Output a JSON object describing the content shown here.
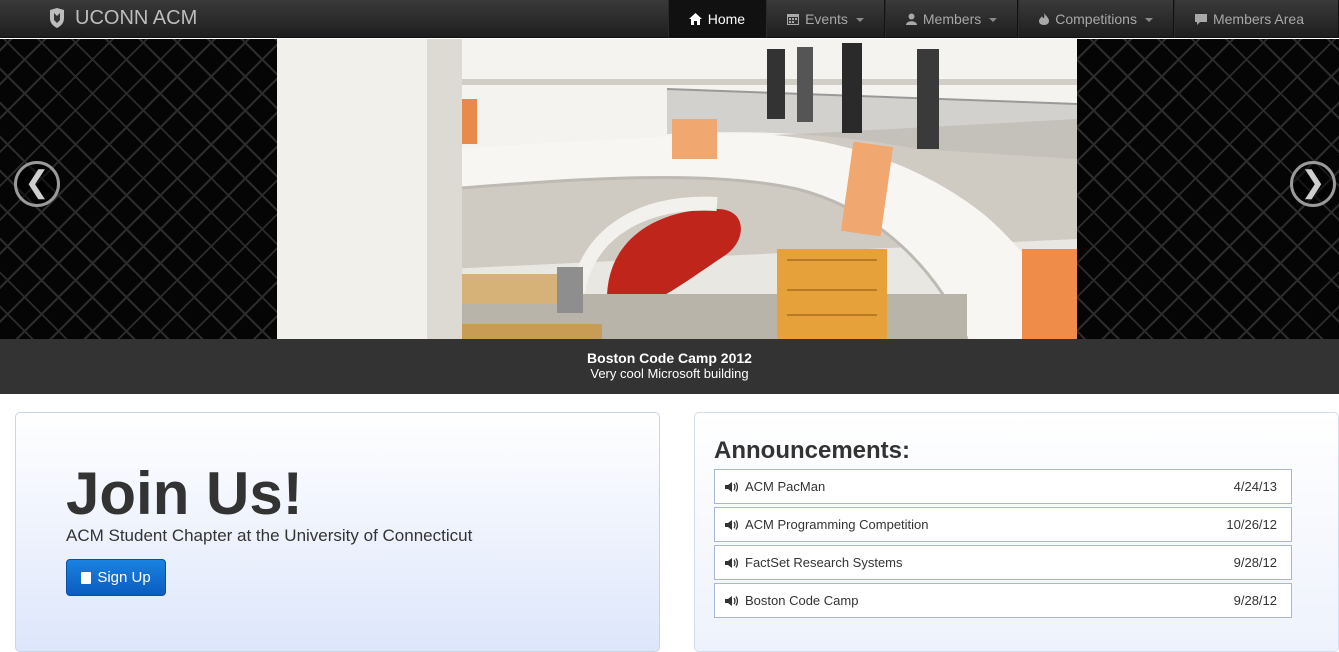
{
  "brand": {
    "name": "UCONN ACM"
  },
  "nav": {
    "items": [
      {
        "label": "Home",
        "icon": "home-icon",
        "active": true,
        "dropdown": false
      },
      {
        "label": "Events",
        "icon": "calendar-icon",
        "active": false,
        "dropdown": true
      },
      {
        "label": "Members",
        "icon": "user-icon",
        "active": false,
        "dropdown": true
      },
      {
        "label": "Competitions",
        "icon": "fire-icon",
        "active": false,
        "dropdown": true
      },
      {
        "label": "Members Area",
        "icon": "comment-icon",
        "active": false,
        "dropdown": false
      }
    ]
  },
  "carousel": {
    "prev": "❮",
    "next": "❯",
    "caption_title": "Boston Code Camp 2012",
    "caption_text": "Very cool Microsoft building"
  },
  "hero": {
    "heading": "Join Us!",
    "subtitle": "ACM Student Chapter at the University of Connecticut",
    "button_label": "Sign Up"
  },
  "announcements": {
    "heading": "Announcements:",
    "items": [
      {
        "title": "ACM PacMan",
        "date": "4/24/13"
      },
      {
        "title": "ACM Programming Competition",
        "date": "10/26/12"
      },
      {
        "title": "FactSet Research Systems",
        "date": "9/28/12"
      },
      {
        "title": "Boston Code Camp",
        "date": "9/28/12"
      }
    ]
  },
  "colors": {
    "navbar": "#2a2a2a",
    "button": "#0b5cc0",
    "caption_bg": "#333333"
  }
}
